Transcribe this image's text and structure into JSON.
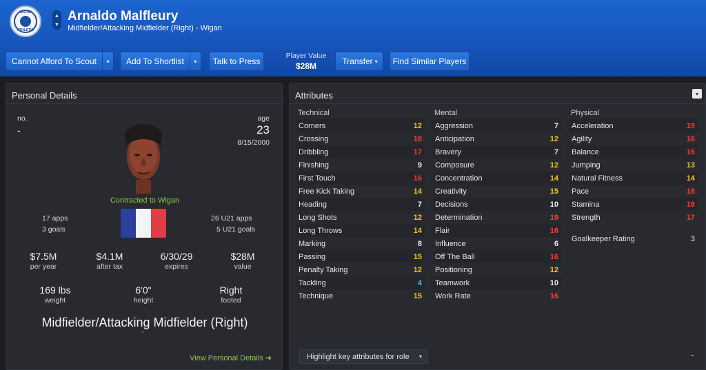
{
  "header": {
    "name": "Arnaldo Malfleury",
    "subtitle": "Midfielder/Attacking Midfielder (Right) - Wigan",
    "crest_top": "WIGAN",
    "crest_bottom": "ATHLETIC",
    "nav_up": "▲",
    "nav_down": "▼"
  },
  "toolbar": {
    "scout_label": "Cannot Afford To Scout",
    "shortlist_label": "Add To Shortlist",
    "press_label": "Talk to Press",
    "player_value_label": "Player Value",
    "player_value": "$28M",
    "transfer_label": "Transfer",
    "similar_label": "Find Similar Players",
    "dropdown_glyph": "▾"
  },
  "personal": {
    "title": "Personal Details",
    "no_label": "no.",
    "no_value": "-",
    "age_label": "age",
    "age_value": "23",
    "dob": "8/15/2000",
    "contract": "Contracted to Wigan",
    "apps": "17 apps",
    "goals": "3 goals",
    "u21_apps": "26 U21 apps",
    "u21_goals": "5 U21 goals",
    "wage": "$7.5M",
    "wage_label": "per year",
    "after_tax": "$4.1M",
    "after_tax_label": "after tax",
    "expires": "6/30/29",
    "expires_label": "expires",
    "value": "$28M",
    "value_label": "value",
    "weight": "169 lbs",
    "weight_label": "weight",
    "height": "6'0\"",
    "height_label": "height",
    "foot": "Right",
    "foot_label": "footed",
    "position": "Midfielder/Attacking Midfielder (Right)",
    "position_dash": "-",
    "view_link": "View Personal Details ➜"
  },
  "colors": {
    "attr_red": "#ff3b30",
    "attr_yellow": "#f2c811",
    "attr_white": "#ececec",
    "attr_blue": "#4ab3ff",
    "flag_blue": "#2a3f9e",
    "flag_white": "#f4f4f4",
    "flag_red": "#e23c45"
  },
  "attributes": {
    "title": "Attributes",
    "menu_glyph": "▾",
    "technical_label": "Technical",
    "mental_label": "Mental",
    "physical_label": "Physical",
    "technical": [
      {
        "name": "Corners",
        "value": "12",
        "color": "#f2c811"
      },
      {
        "name": "Crossing",
        "value": "18",
        "color": "#ff3b30"
      },
      {
        "name": "Dribbling",
        "value": "17",
        "color": "#ff3b30"
      },
      {
        "name": "Finishing",
        "value": "9",
        "color": "#ececec"
      },
      {
        "name": "First Touch",
        "value": "16",
        "color": "#ff3b30"
      },
      {
        "name": "Free Kick Taking",
        "value": "14",
        "color": "#f2c811"
      },
      {
        "name": "Heading",
        "value": "7",
        "color": "#ececec"
      },
      {
        "name": "Long Shots",
        "value": "12",
        "color": "#f2c811"
      },
      {
        "name": "Long Throws",
        "value": "14",
        "color": "#f2c811"
      },
      {
        "name": "Marking",
        "value": "8",
        "color": "#ececec"
      },
      {
        "name": "Passing",
        "value": "15",
        "color": "#f2c811"
      },
      {
        "name": "Penalty Taking",
        "value": "12",
        "color": "#f2c811"
      },
      {
        "name": "Tackling",
        "value": "4",
        "color": "#4ab3ff"
      },
      {
        "name": "Technique",
        "value": "15",
        "color": "#f2c811"
      }
    ],
    "mental": [
      {
        "name": "Aggression",
        "value": "7",
        "color": "#ececec"
      },
      {
        "name": "Anticipation",
        "value": "12",
        "color": "#f2c811"
      },
      {
        "name": "Bravery",
        "value": "7",
        "color": "#ececec"
      },
      {
        "name": "Composure",
        "value": "12",
        "color": "#f2c811"
      },
      {
        "name": "Concentration",
        "value": "14",
        "color": "#f2c811"
      },
      {
        "name": "Creativity",
        "value": "15",
        "color": "#f2c811"
      },
      {
        "name": "Decisions",
        "value": "10",
        "color": "#ececec"
      },
      {
        "name": "Determination",
        "value": "19",
        "color": "#ff3b30"
      },
      {
        "name": "Flair",
        "value": "16",
        "color": "#ff3b30"
      },
      {
        "name": "Influence",
        "value": "6",
        "color": "#ececec"
      },
      {
        "name": "Off The Ball",
        "value": "16",
        "color": "#ff3b30"
      },
      {
        "name": "Positioning",
        "value": "12",
        "color": "#f2c811"
      },
      {
        "name": "Teamwork",
        "value": "10",
        "color": "#ececec"
      },
      {
        "name": "Work Rate",
        "value": "16",
        "color": "#ff3b30"
      }
    ],
    "physical": [
      {
        "name": "Acceleration",
        "value": "19",
        "color": "#ff3b30"
      },
      {
        "name": "Agility",
        "value": "16",
        "color": "#ff3b30"
      },
      {
        "name": "Balance",
        "value": "16",
        "color": "#ff3b30"
      },
      {
        "name": "Jumping",
        "value": "13",
        "color": "#f2c811"
      },
      {
        "name": "Natural Fitness",
        "value": "14",
        "color": "#f2c811"
      },
      {
        "name": "Pace",
        "value": "18",
        "color": "#ff3b30"
      },
      {
        "name": "Stamina",
        "value": "16",
        "color": "#ff3b30"
      },
      {
        "name": "Strength",
        "value": "17",
        "color": "#ff3b30"
      }
    ],
    "goalkeeper_label": "Goalkeeper Rating",
    "goalkeeper_value": "3",
    "highlight_label": "Highlight key attributes for role",
    "zoom_dash": "-"
  }
}
